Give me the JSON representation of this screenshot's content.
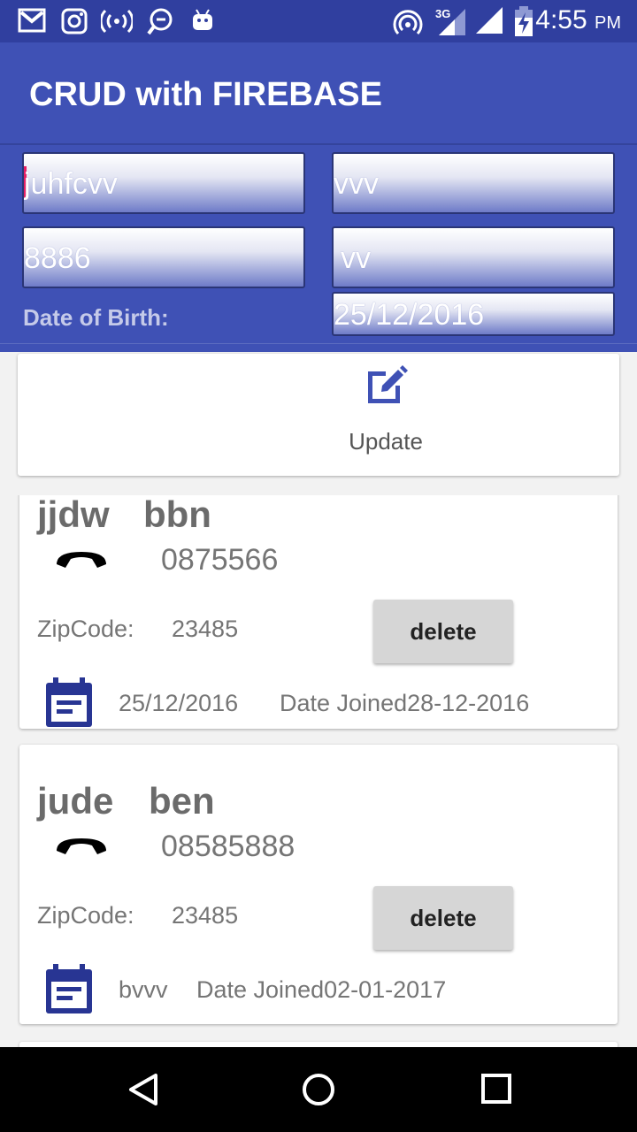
{
  "status_bar": {
    "time": "4:55",
    "ampm": "PM",
    "network": "3G",
    "icons_left": [
      "gmail-icon",
      "instagram-icon",
      "hotspot-icon",
      "chat-icon",
      "android-icon"
    ],
    "icons_right": [
      "wifi-icon",
      "signal-3g-icon",
      "signal-icon",
      "battery-charging-icon"
    ]
  },
  "app_bar": {
    "title": "CRUD with FIREBASE"
  },
  "form": {
    "first_name": "juhfcvv",
    "last_name": "vvv",
    "phone": "8886",
    "zip": "vv",
    "dob_label": "Date of Birth:",
    "dob_value": "25/12/2016"
  },
  "update_card": {
    "label": "Update",
    "icon": "edit-icon"
  },
  "contacts": [
    {
      "first": "jjdw",
      "last": "bbn",
      "phone": "0875566",
      "zip_label": "ZipCode:",
      "zip": "23485",
      "delete_label": "delete",
      "dob": "25/12/2016",
      "joined": "Date Joined28-12-2016"
    },
    {
      "first": "jude",
      "last": "ben",
      "phone": "08585888",
      "zip_label": "ZipCode:",
      "zip": "23485",
      "delete_label": "delete",
      "dob": "bvvv",
      "joined": "Date Joined02-01-2017"
    }
  ],
  "colors": {
    "status_bar": "#303f9f",
    "primary": "#3f51b5",
    "accent": "#e91e63",
    "icon_blue": "#3f51b5"
  },
  "nav_bar": {
    "buttons": [
      "back-icon",
      "home-icon",
      "recents-icon"
    ]
  }
}
